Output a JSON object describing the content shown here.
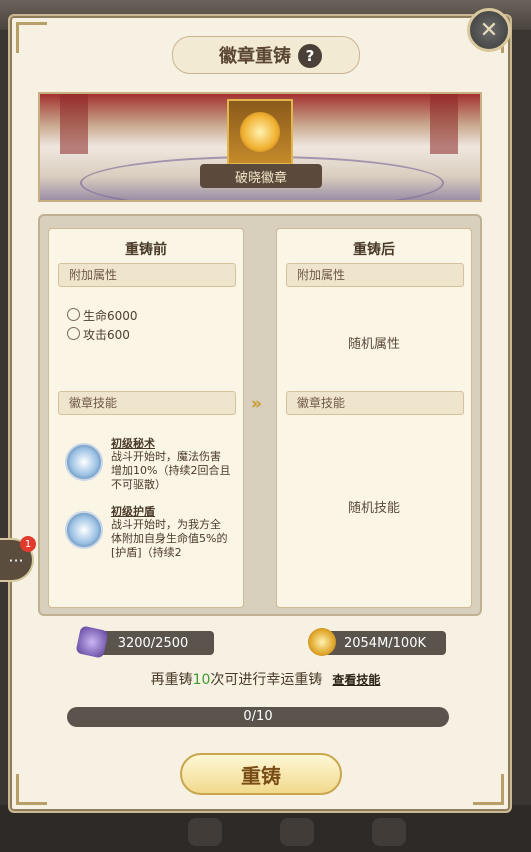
{
  "dialog": {
    "title": "徽章重铸",
    "help_glyph": "?",
    "close_glyph": "✕",
    "badge_name": "破晓徽章"
  },
  "before": {
    "title": "重铸前",
    "attr_header": "附加属性",
    "stats": [
      "生命6000",
      "攻击600"
    ],
    "skill_header": "徽章技能",
    "skills": [
      {
        "name": "初级秘术",
        "desc": "战斗开始时，魔法伤害增加10%（持续2回合且不可驱散）"
      },
      {
        "name": "初级护盾",
        "desc": "战斗开始时，为我方全体附加自身生命值5%的[护盾]（持续2"
      }
    ]
  },
  "after": {
    "title": "重铸后",
    "attr_header": "附加属性",
    "random_attr": "随机属性",
    "skill_header": "徽章技能",
    "random_skill": "随机技能"
  },
  "arrow_glyph": "»",
  "chat": {
    "glyph": "···",
    "badge_count": "1"
  },
  "resources": {
    "material": "3200/2500",
    "gold": "2054M/100K"
  },
  "lucky": {
    "prefix": "再重铸",
    "count": "10",
    "suffix": "次可进行幸运重铸",
    "link": "查看技能"
  },
  "progress": {
    "text": "0/10",
    "fraction": 0.0
  },
  "reforge_button": "重铸",
  "colors": {
    "accent": "#c89a2c",
    "panel": "#f7f1e3",
    "lucky_green": "#3e9b2e"
  }
}
